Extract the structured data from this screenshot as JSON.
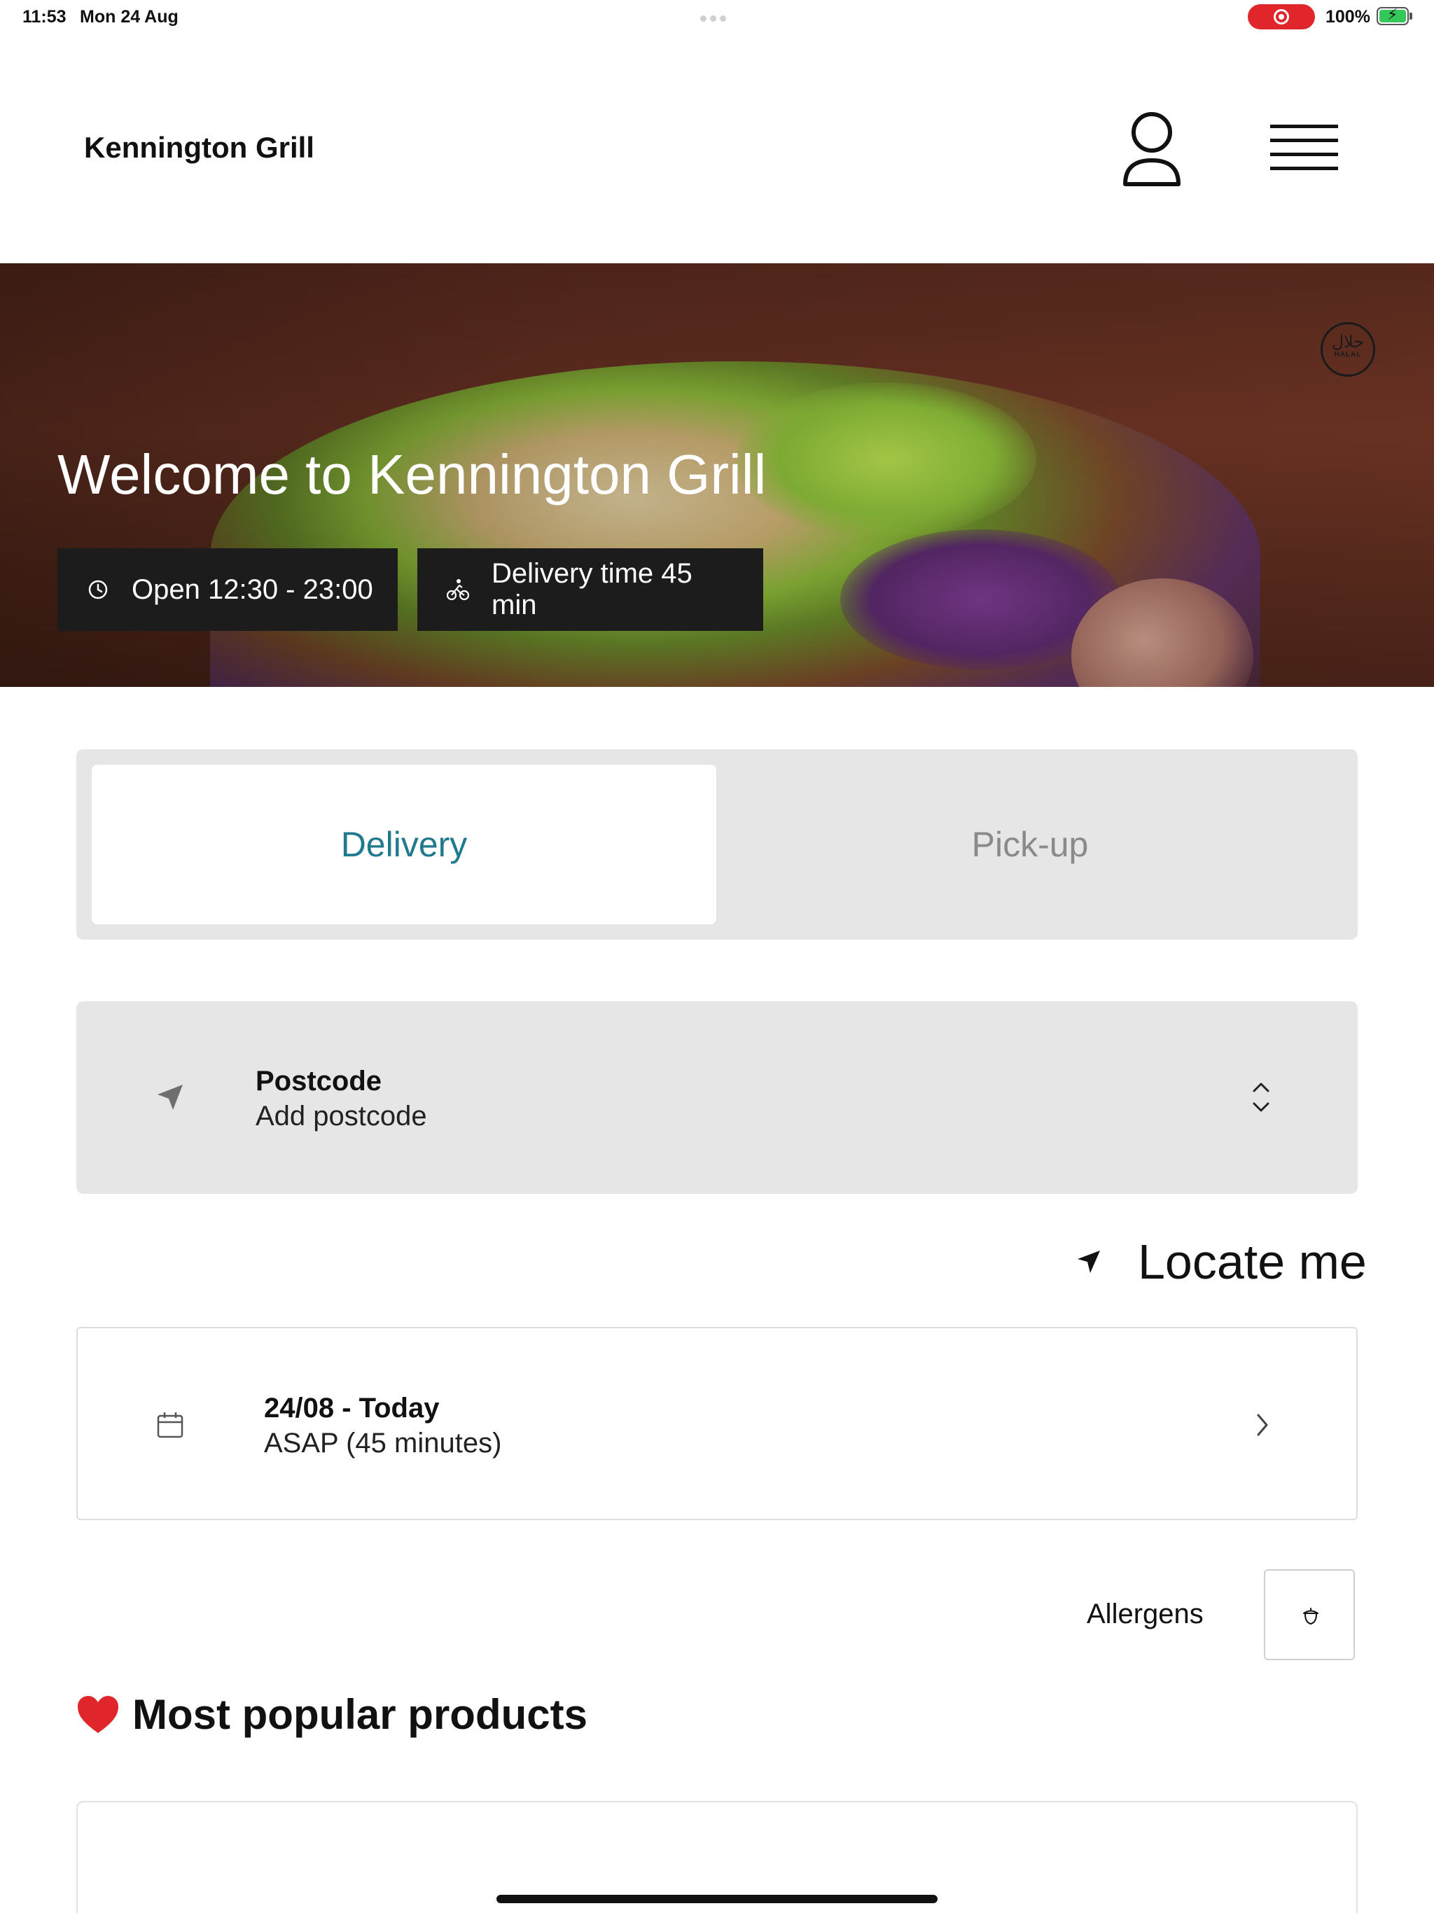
{
  "status_bar": {
    "time": "11:53",
    "date": "Mon 24 Aug",
    "battery": "100%",
    "icons": [
      "screen-recording-icon",
      "battery-charging-icon"
    ]
  },
  "header": {
    "brand": "Kennington Grill",
    "icons": [
      "user-icon",
      "menu-icon"
    ]
  },
  "hero": {
    "title": "Welcome to Kennington Grill",
    "badge_arabic": "حلال",
    "badge_text": "HALAL",
    "open_hours": "Open 12:30 - 23:00",
    "delivery_time": "Delivery time 45 min",
    "icons": [
      "clock-icon",
      "cyclist-icon"
    ]
  },
  "mode": {
    "delivery_label": "Delivery",
    "pickup_label": "Pick-up",
    "selected": "Delivery",
    "accent_color": "#1e7a8c"
  },
  "postcode": {
    "label": "Postcode",
    "value": "Add postcode",
    "icons": [
      "location-arrow-icon",
      "chevron-up-down-icon"
    ]
  },
  "locate": {
    "label": "Locate me",
    "icon": "location-arrow-icon"
  },
  "schedule": {
    "date": "24/08 - Today",
    "time": "ASAP (45 minutes)",
    "icons": [
      "calendar-icon",
      "chevron-right-icon"
    ]
  },
  "allergens": {
    "label": "Allergens",
    "icon": "acorn-icon"
  },
  "popular": {
    "title": "Most popular products",
    "icon": "heart-icon"
  }
}
